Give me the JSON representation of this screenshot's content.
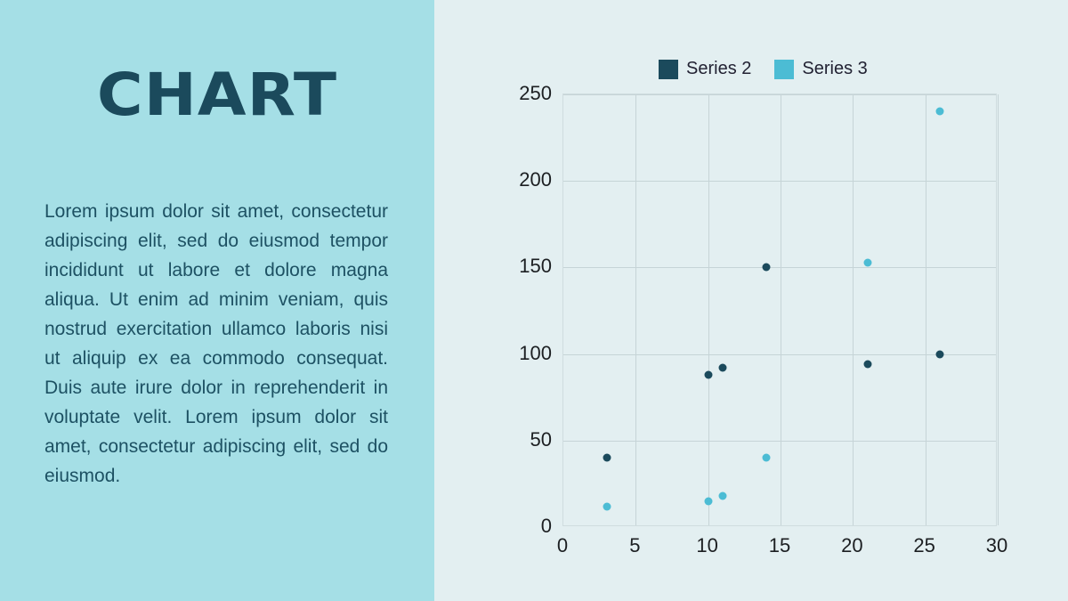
{
  "slide": {
    "title": "CHART",
    "body_text": "Lorem ipsum dolor sit amet, consectetur adipiscing elit, sed do eiusmod tempor incididunt ut labore et dolore magna aliqua. Ut enim ad minim veniam, quis nostrud exercitation ullamco laboris nisi ut aliquip ex ea commodo consequat. Duis aute irure dolor in reprehenderit in voluptate velit. Lorem ipsum dolor sit amet, consectetur adipiscing elit, sed do eiusmod.",
    "colors": {
      "panel_background": "#a5dfe6",
      "chart_background": "#e3eff1",
      "title_color": "#1b4a5c",
      "body_color": "#1d5163",
      "series2": "#1b4a5c",
      "series3": "#4cbcd4",
      "grid": "#c6d4d7"
    }
  },
  "chart_data": {
    "type": "scatter",
    "title": "",
    "xlabel": "",
    "ylabel": "",
    "xlim": [
      0,
      30
    ],
    "ylim": [
      0,
      250
    ],
    "xticks": [
      "0",
      "5",
      "10",
      "15",
      "20",
      "25",
      "30"
    ],
    "yticks": [
      "0",
      "50",
      "100",
      "150",
      "200",
      "250"
    ],
    "grid": true,
    "legend_position": "top-center",
    "series": [
      {
        "name": "Series 2",
        "color": "#1b4a5c",
        "points": [
          [
            3,
            40
          ],
          [
            10,
            88
          ],
          [
            11,
            92
          ],
          [
            14,
            150
          ],
          [
            21,
            94
          ],
          [
            26,
            100
          ]
        ]
      },
      {
        "name": "Series 3",
        "color": "#4cbcd4",
        "points": [
          [
            3,
            12
          ],
          [
            10,
            15
          ],
          [
            11,
            18
          ],
          [
            14,
            40
          ],
          [
            21,
            153
          ],
          [
            26,
            240
          ]
        ]
      }
    ]
  }
}
